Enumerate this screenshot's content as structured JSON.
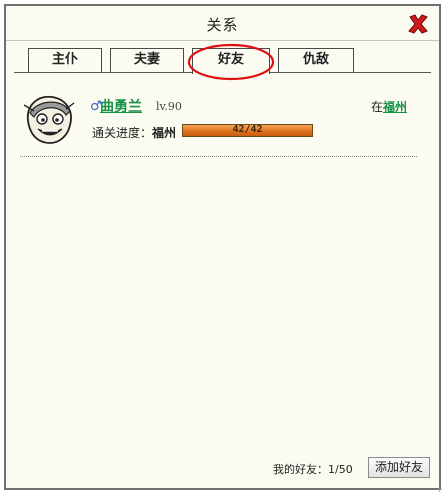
{
  "window": {
    "title": "关系"
  },
  "tabs": [
    {
      "label": "主仆",
      "active": false
    },
    {
      "label": "夫妻",
      "active": false
    },
    {
      "label": "好友",
      "active": true
    },
    {
      "label": "仇敌",
      "active": false
    }
  ],
  "friends": [
    {
      "gender_icon": "male-icon",
      "name": "曲勇兰",
      "level": "lv.90",
      "location_prefix": "在",
      "location": "福州",
      "progress_label": "通关进度：",
      "progress_city": "福州",
      "progress_text": "42/42",
      "progress_fraction": 1.0
    }
  ],
  "footer": {
    "count_label": "我的好友：1/50",
    "add_button": "添加好友"
  },
  "colors": {
    "accent_green": "#159245",
    "close_red": "#d01a1a",
    "progress_orange": "#e0731e"
  }
}
